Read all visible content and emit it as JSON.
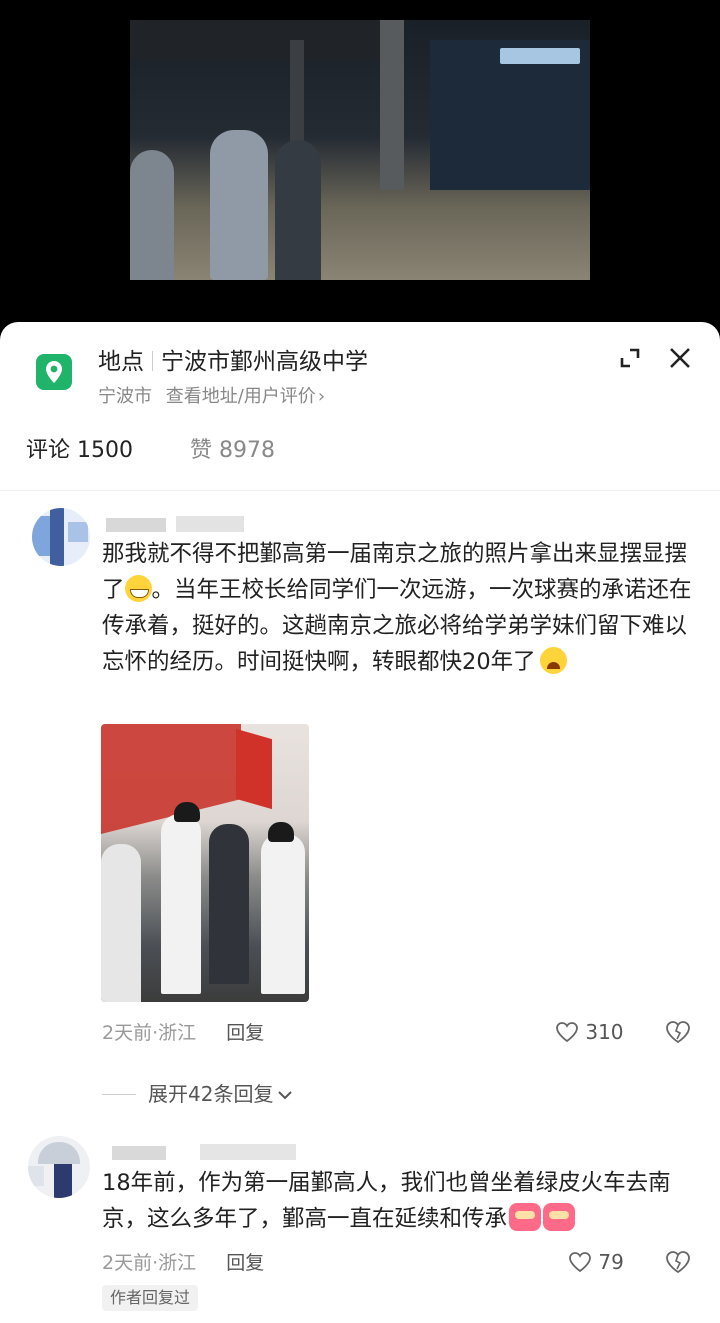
{
  "location": {
    "label": "地点",
    "name": "宁波市鄞州高级中学",
    "city": "宁波市",
    "link": "查看地址/用户评价",
    "chevron": "›"
  },
  "stats": {
    "comments": "评论 1500",
    "likes": "赞 8978"
  },
  "comments": [
    {
      "text_part1": "那我就不得不把鄞高第一届南京之旅的照片拿出来显摆显摆了",
      "text_part2": "。当年王校长给同学们一次远游，一次球赛的承诺还在传承着，挺好的。这趟南京之旅必将给学弟学妹们留下难以忘怀的经历。时间挺快啊，转眼都快20年了",
      "time_loc": "2天前·浙江",
      "reply": "回复",
      "likes": "310",
      "expand": "展开42条回复"
    },
    {
      "text": "18年前，作为第一届鄞高人，我们也曾坐着绿皮火车去南京，这么多年了，鄞高一直在延续和传承",
      "time_loc": "2天前·浙江",
      "reply": "回复",
      "likes": "79",
      "author_tag": "作者回复过"
    }
  ],
  "icons": {
    "pin": "map-pin-icon",
    "expand": "expand-icon",
    "close": "close-icon",
    "heart": "heart-icon",
    "dislike": "dislike-icon",
    "chevron_down": "chevron-down-icon",
    "emoji_grin": "grin-emoji",
    "emoji_cry": "laugh-cry-emoji",
    "emoji_jiayou": "jiayou-emoji"
  },
  "colors": {
    "pin_green": "#1fb46a",
    "sheet_bg": "#ffffff",
    "muted_text": "#888888"
  }
}
